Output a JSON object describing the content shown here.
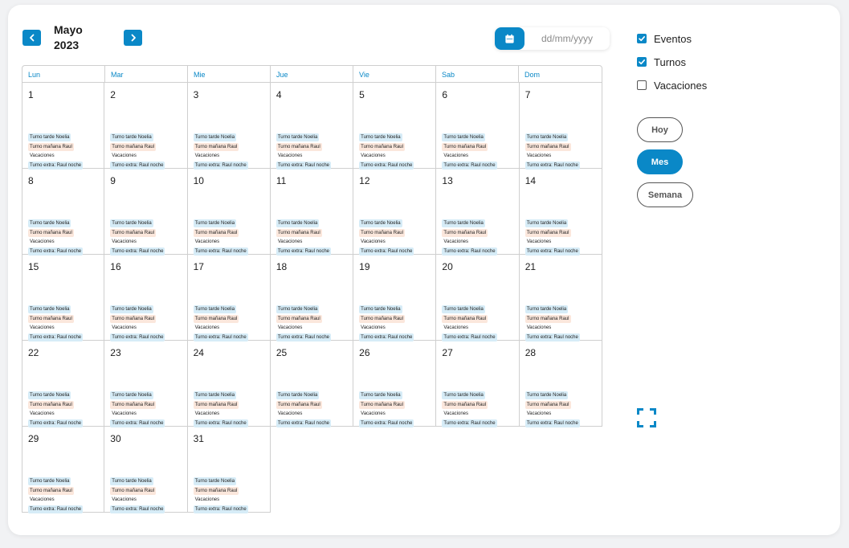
{
  "header": {
    "month": "Mayo",
    "year": "2023",
    "prev_icon": "chevron-left-icon",
    "next_icon": "chevron-right-icon"
  },
  "date_picker": {
    "placeholder": "dd/mm/yyyy",
    "icon": "calendar-icon"
  },
  "weekdays": [
    "Lun",
    "Mar",
    "Mie",
    "Jue",
    "Vie",
    "Sab",
    "Dom"
  ],
  "days": [
    "1",
    "2",
    "3",
    "4",
    "5",
    "6",
    "7",
    "8",
    "9",
    "10",
    "11",
    "12",
    "13",
    "14",
    "15",
    "16",
    "17",
    "18",
    "19",
    "20",
    "21",
    "22",
    "23",
    "24",
    "25",
    "26",
    "27",
    "28",
    "29",
    "30",
    "31"
  ],
  "day_events": [
    {
      "label": "Turno tarde Noelia",
      "color": "#d6ecf7"
    },
    {
      "label": "Turno mañana Raul",
      "color": "#fbe7dc"
    },
    {
      "label": "Vacaciones",
      "color": "#ffffff"
    },
    {
      "label": "Turno extra: Raul noche",
      "color": "#d6ecf7"
    }
  ],
  "filters": [
    {
      "label": "Eventos",
      "checked": true
    },
    {
      "label": "Turnos",
      "checked": true
    },
    {
      "label": "Vacaciones",
      "checked": false
    }
  ],
  "views": {
    "today": "Hoy",
    "month": "Mes",
    "week": "Semana",
    "active": "month"
  },
  "colors": {
    "accent": "#0a88c7",
    "shift_blue": "#d6ecf7",
    "shift_peach": "#fbe7dc",
    "border": "#cfcfcf"
  },
  "fullscreen_icon": "fullscreen-icon"
}
